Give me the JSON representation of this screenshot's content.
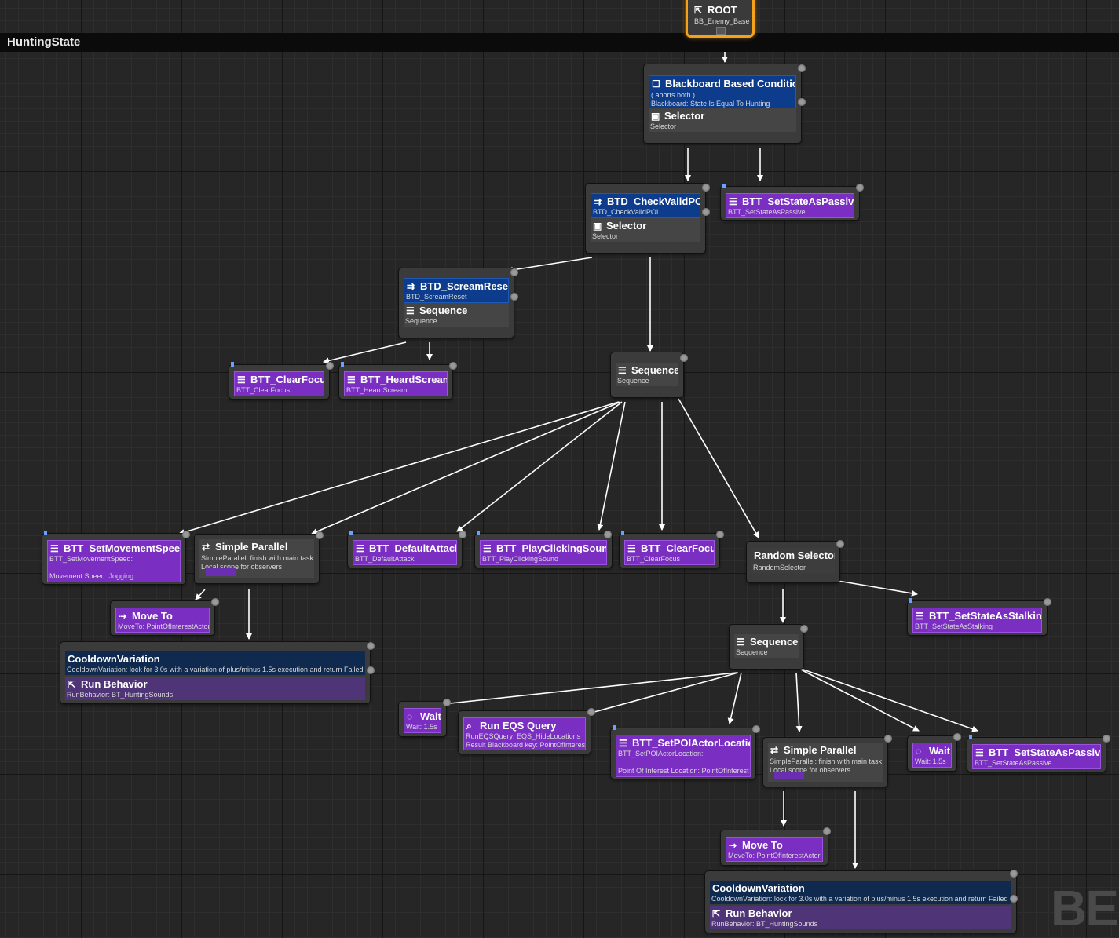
{
  "graph_title": "HuntingState",
  "watermark": "BEH",
  "nodes": {
    "root": {
      "title": "ROOT",
      "sub": "BB_Enemy_Base"
    },
    "bb_cond": {
      "title": "Blackboard Based Condition",
      "line1": "( aborts both )",
      "line2": "Blackboard: State Is Equal To Hunting"
    },
    "selector_main": {
      "title": "Selector",
      "sub": "Selector"
    },
    "checkvalid": {
      "title": "BTD_CheckValidPOI",
      "sub": "BTD_CheckValidPOI"
    },
    "selector_poi": {
      "title": "Selector",
      "sub": "Selector"
    },
    "passive_top": {
      "title": "BTT_SetStateAsPassive",
      "sub": "BTT_SetStateAsPassive"
    },
    "screamreset": {
      "title": "BTD_ScreamReset",
      "sub": "BTD_ScreamReset"
    },
    "seq_scream": {
      "title": "Sequence",
      "sub": "Sequence"
    },
    "clearfocus_a": {
      "title": "BTT_ClearFocus",
      "sub": "BTT_ClearFocus"
    },
    "heardscream": {
      "title": "BTT_HeardScream",
      "sub": "BTT_HeardScream"
    },
    "seq_mid": {
      "title": "Sequence",
      "sub": "Sequence"
    },
    "movespeed": {
      "title": "BTT_SetMovementSpeed",
      "sub": "BTT_SetMovementSpeed:",
      "sub2": "Movement Speed: Jogging"
    },
    "parallel_a": {
      "title": "Simple Parallel",
      "sub": "SimpleParallel: finish with main task",
      "sub2": "Local scope for observers"
    },
    "defattack": {
      "title": "BTT_DefaultAttack",
      "sub": "BTT_DefaultAttack"
    },
    "clicksound": {
      "title": "BTT_PlayClickingSound",
      "sub": "BTT_PlayClickingSound"
    },
    "clearfocus_b": {
      "title": "BTT_ClearFocus",
      "sub": "BTT_ClearFocus"
    },
    "randsel": {
      "title": "Random Selector",
      "sub": "RandomSelector"
    },
    "moveto_a": {
      "title": "Move To",
      "sub": "MoveTo: PointOfInterestActor"
    },
    "cooldown_a": {
      "title": "CooldownVariation",
      "sub": "CooldownVariation: lock for 3.0s with a variation of plus/minus 1.5s execution and return Failed"
    },
    "runbeh_a": {
      "title": "Run Behavior",
      "sub": "RunBehavior: BT_HuntingSounds"
    },
    "stalking": {
      "title": "BTT_SetStateAsStalking",
      "sub": "BTT_SetStateAsStalking"
    },
    "seq_low": {
      "title": "Sequence",
      "sub": "Sequence"
    },
    "wait_a": {
      "title": "Wait",
      "sub": "Wait: 1.5s"
    },
    "eqs": {
      "title": "Run EQS Query",
      "sub": "RunEQSQuery: EQS_HideLocations",
      "sub2": "Result Blackboard key: PointOfInterest"
    },
    "setpoi": {
      "title": "BTT_SetPOIActorLocation",
      "sub": "BTT_SetPOIActorLocation:",
      "sub2": "Point Of Interest Location: PointOfInterest"
    },
    "parallel_b": {
      "title": "Simple Parallel",
      "sub": "SimpleParallel: finish with main task",
      "sub2": "Local scope for observers"
    },
    "wait_b": {
      "title": "Wait",
      "sub": "Wait: 1.5s"
    },
    "passive_low": {
      "title": "BTT_SetStateAsPassive",
      "sub": "BTT_SetStateAsPassive"
    },
    "moveto_b": {
      "title": "Move To",
      "sub": "MoveTo: PointOfInterestActor"
    },
    "cooldown_b": {
      "title": "CooldownVariation",
      "sub": "CooldownVariation: lock for 3.0s with a variation of plus/minus 1.5s execution and return Failed"
    },
    "runbeh_b": {
      "title": "Run Behavior",
      "sub": "RunBehavior: BT_HuntingSounds"
    }
  },
  "colors": {
    "decorator": "#0d3c8c",
    "task": "#7a2fc2",
    "root_border": "#f3a21a",
    "edge": "#ffffff"
  }
}
